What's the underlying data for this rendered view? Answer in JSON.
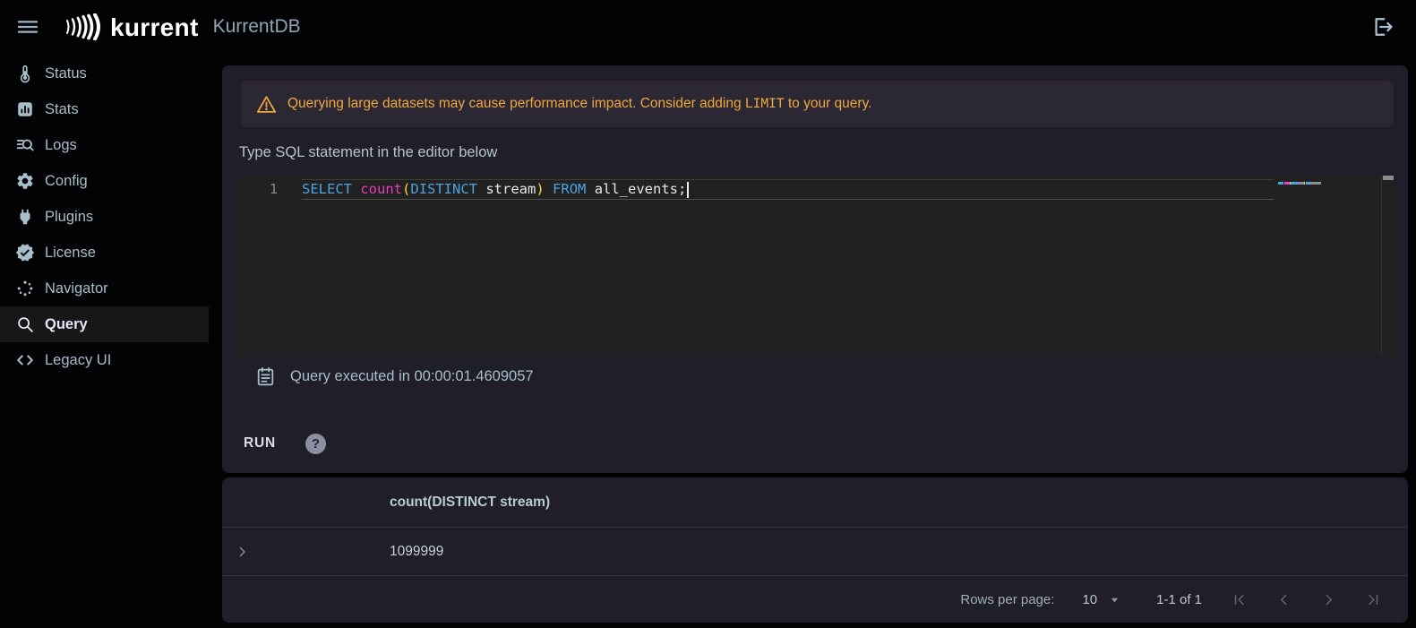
{
  "topbar": {
    "brand": "kurrent",
    "app_title": "KurrentDB",
    "menu_icon": "hamburger-icon",
    "logout_icon": "logout-icon"
  },
  "sidebar": {
    "items": [
      {
        "label": "Status",
        "icon": "thermometer-icon",
        "selected": false
      },
      {
        "label": "Stats",
        "icon": "stats-icon",
        "selected": false
      },
      {
        "label": "Logs",
        "icon": "logs-search-icon",
        "selected": false
      },
      {
        "label": "Config",
        "icon": "gear-icon",
        "selected": false
      },
      {
        "label": "Plugins",
        "icon": "plug-icon",
        "selected": false
      },
      {
        "label": "License",
        "icon": "license-badge-icon",
        "selected": false
      },
      {
        "label": "Navigator",
        "icon": "navigator-dots-icon",
        "selected": false
      },
      {
        "label": "Query",
        "icon": "search-icon",
        "selected": true
      },
      {
        "label": "Legacy UI",
        "icon": "code-brackets-icon",
        "selected": false
      }
    ]
  },
  "query_page": {
    "warning": {
      "icon": "warning-triangle-icon",
      "text_before": "Querying large datasets may cause performance impact. Consider adding ",
      "code": "LIMIT",
      "text_after": " to your query."
    },
    "editor_label": "Type SQL statement in the editor below",
    "editor": {
      "line_number": "1",
      "tokens": [
        {
          "text": "SELECT",
          "type": "keyword"
        },
        {
          "text": " ",
          "type": "plain"
        },
        {
          "text": "count",
          "type": "function"
        },
        {
          "text": "(",
          "type": "paren"
        },
        {
          "text": "DISTINCT",
          "type": "keyword"
        },
        {
          "text": " stream",
          "type": "plain"
        },
        {
          "text": ")",
          "type": "paren"
        },
        {
          "text": " ",
          "type": "plain"
        },
        {
          "text": "FROM",
          "type": "keyword"
        },
        {
          "text": " all_events;",
          "type": "plain"
        }
      ]
    },
    "execution_status": "Query executed in 00:00:01.4609057",
    "execution_icon": "calendar-icon",
    "run_button": "RUN",
    "help_icon": "?"
  },
  "results": {
    "column_header": "count(DISTINCT stream)",
    "rows": [
      {
        "value": "1099999"
      }
    ],
    "pagination": {
      "rows_per_page_label": "Rows per page:",
      "rows_per_page_value": "10",
      "range_label": "1-1 of 1"
    }
  },
  "colors": {
    "warning": "#efa73e",
    "sql_keyword": "#4ba3e3",
    "sql_function": "#e83dbe",
    "sql_paren": "#ffd23f",
    "sql_plain": "#e6e6e6"
  }
}
